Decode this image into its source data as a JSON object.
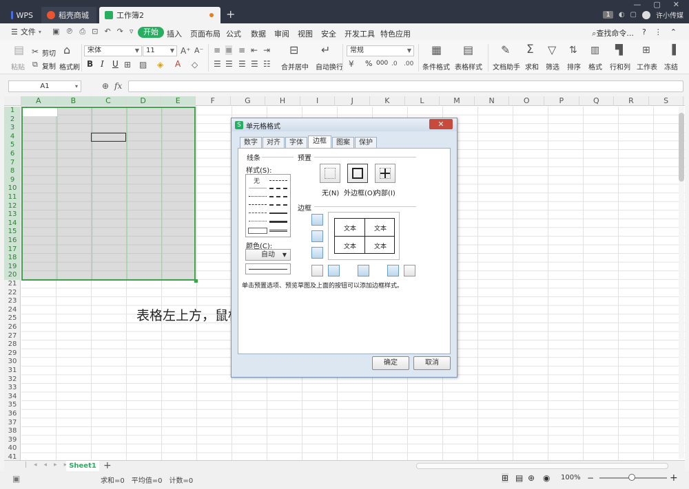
{
  "titlebar": {
    "tabs": [
      {
        "label": "WPS"
      },
      {
        "label": "稻壳商城"
      },
      {
        "label": "工作簿2"
      }
    ],
    "page_badge": "1",
    "user_name": "许小传媒"
  },
  "menubar": {
    "file_label": "文件",
    "start_label": "开始",
    "items": [
      "插入",
      "页面布局",
      "公式",
      "数据",
      "审阅",
      "视图",
      "安全",
      "开发工具",
      "特色应用"
    ],
    "search_label": "查找命令...",
    "help_label": "?"
  },
  "ribbon": {
    "paste": "粘贴",
    "cut": "剪切",
    "copy": "复制",
    "format_painter": "格式刷",
    "font_name": "宋体",
    "font_size": "11",
    "bold": "B",
    "italic": "I",
    "underline": "U",
    "merge_center": "合并居中",
    "wrap_text": "自动换行",
    "number_format": "常规",
    "percent": "%",
    "thousands": "000",
    "conditional_format": "条件格式",
    "table_style": "表格样式",
    "doc_assistant": "文档助手",
    "sum": "求和",
    "filter": "筛选",
    "sort": "排序",
    "format": "格式",
    "rows_cols": "行和列",
    "worksheet": "工作表",
    "freeze": "冻结"
  },
  "formula_bar": {
    "cell_ref": "A1",
    "fx_label": "fx"
  },
  "sheet": {
    "columns": [
      "A",
      "B",
      "C",
      "D",
      "E",
      "F",
      "G",
      "H",
      "I",
      "J",
      "K",
      "L",
      "M",
      "N",
      "O",
      "P",
      "Q",
      "R",
      "S"
    ],
    "rows": [
      "1",
      "2",
      "3",
      "4",
      "5",
      "6",
      "7",
      "8",
      "9",
      "10",
      "11",
      "12",
      "13",
      "14",
      "15",
      "16",
      "17",
      "18",
      "19",
      "20",
      "21",
      "22",
      "23",
      "24",
      "25",
      "26",
      "27",
      "28",
      "29",
      "30",
      "31",
      "32",
      "33",
      "34",
      "35",
      "36",
      "37",
      "38",
      "39",
      "40",
      "41"
    ],
    "selected_columns": 5,
    "selected_rows": 20,
    "caption": "表格左上方，鼠标左键按住别动右下拉出相应的格"
  },
  "sheet_tabs": {
    "active": "Sheet1",
    "add": "+"
  },
  "status": {
    "sum": "求和=0",
    "average": "平均值=0",
    "count": "计数=0",
    "zoom": "100%"
  },
  "dialog": {
    "title": "单元格格式",
    "tabs": [
      "数字",
      "对齐",
      "字体",
      "边框",
      "图案",
      "保护"
    ],
    "active_tab": "边框",
    "line_group": "线条",
    "style_label": "样式(S):",
    "style_none": "无",
    "color_label": "颜色(C):",
    "color_value": "自动",
    "preset_group": "预置",
    "preset_none": "无(N)",
    "preset_outline": "外边框(O)",
    "preset_inside": "内部(I)",
    "border_group": "边框",
    "preview_text": "文本",
    "hint": "单击预置选项、预览草图及上面的按钮可以添加边框样式。",
    "ok": "确定",
    "cancel": "取消"
  }
}
